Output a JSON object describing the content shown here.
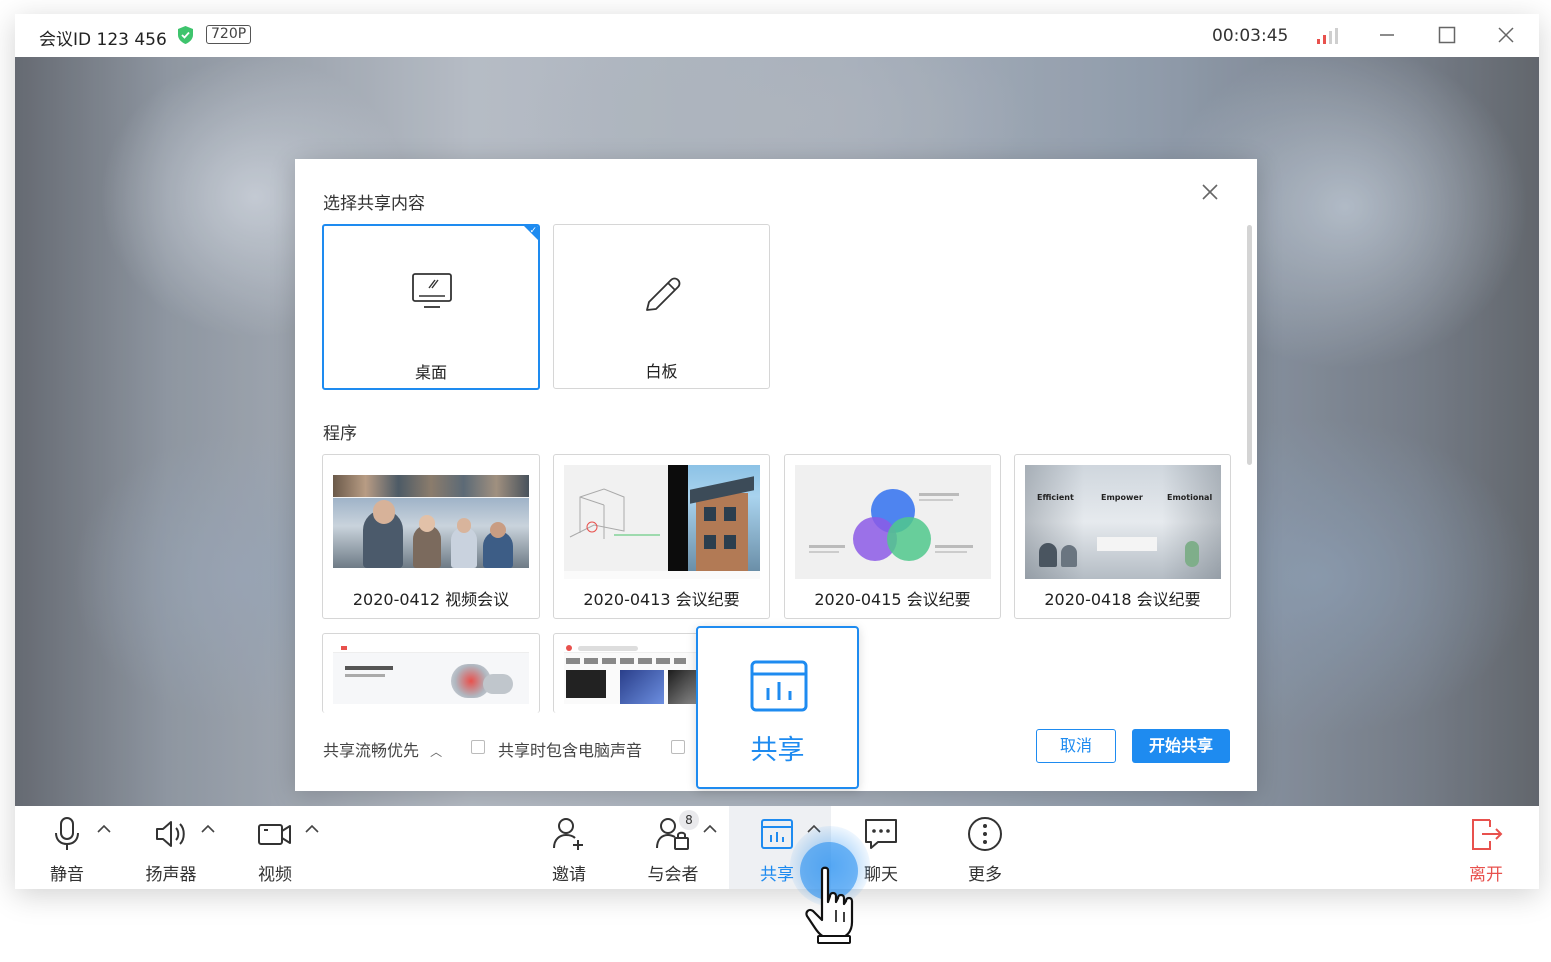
{
  "titlebar": {
    "meeting_id": "会议ID 123 456",
    "resolution": "720P",
    "timer": "00:03:45",
    "shield_color": "#3ec46d",
    "signal_color": "#e8514d"
  },
  "dialog": {
    "title": "选择共享内容",
    "cards": [
      {
        "label": "桌面",
        "icon": "monitor-icon",
        "selected": true
      },
      {
        "label": "白板",
        "icon": "pencil-icon",
        "selected": false
      }
    ],
    "programs_label": "程序",
    "programs": [
      {
        "label": "2020-0412 视频会议"
      },
      {
        "label": "2020-0413 会议纪要"
      },
      {
        "label": "2020-0415 会议纪要"
      },
      {
        "label": "2020-0418 会议纪要"
      }
    ],
    "thumb_texts": {
      "efficient": "Efficient",
      "empower": "Empower",
      "emotional": "Emotional"
    },
    "footer": {
      "quality": "共享流畅优先",
      "include_audio": "共享时包含电脑声音"
    },
    "cancel_label": "取消",
    "start_label": "开始共享"
  },
  "toolbar": {
    "mute": "静音",
    "speaker": "扬声器",
    "video": "视频",
    "invite": "邀请",
    "participants": "与会者",
    "participants_count": "8",
    "share": "共享",
    "chat": "聊天",
    "more": "更多",
    "leave": "离开"
  },
  "tooltip": {
    "label": "共享"
  },
  "colors": {
    "accent": "#1e8bf0",
    "leave": "#e8514d"
  }
}
